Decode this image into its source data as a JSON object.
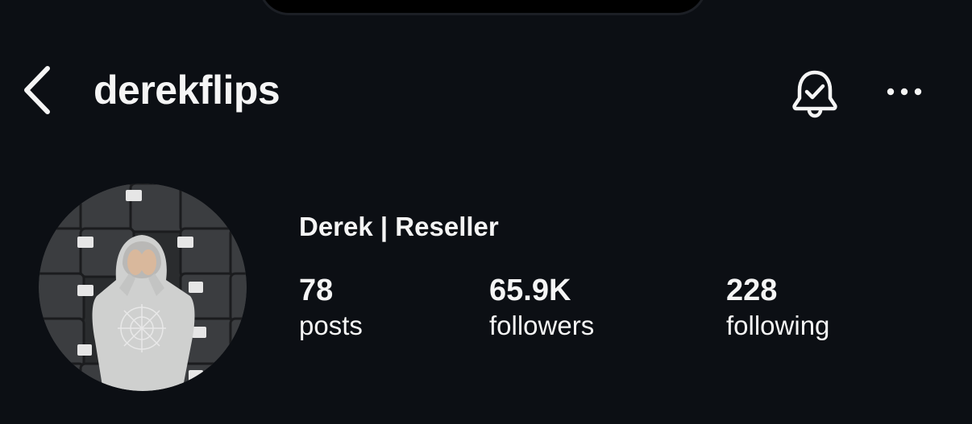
{
  "header": {
    "username": "derekflips",
    "back_icon": "chevron-left-icon",
    "bell_icon": "bell-check-icon",
    "more_icon": "more-horizontal-icon"
  },
  "profile": {
    "display_name": "Derek | Reseller",
    "avatar": "profile-photo",
    "stats": [
      {
        "count": "78",
        "label": "posts"
      },
      {
        "count": "65.9K",
        "label": "followers"
      },
      {
        "count": "228",
        "label": "following"
      }
    ]
  },
  "colors": {
    "background": "#0c0f14",
    "text": "#f5f5f5"
  }
}
